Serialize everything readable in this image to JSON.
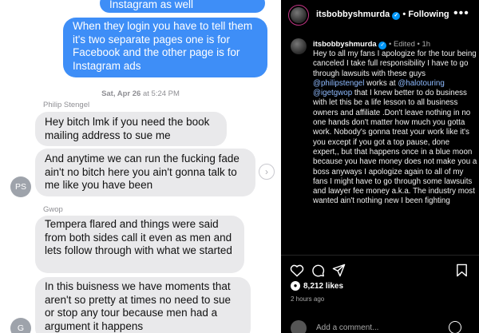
{
  "messages": {
    "sent_1": "Instagram as well",
    "sent_2": "When they login you have to tell them it's two separate pages one is for Facebook and the other page is for Instagram ads",
    "timestamp_day": "Sat, Apr 26",
    "timestamp_time": "at 5:24 PM",
    "philip_name": "Philip Stengel",
    "philip_msg_1": "Hey bitch lmk if you need the book mailing address to sue me",
    "philip_msg_2": "And anytime we can run the fucking fade ain't no bitch here you ain't gonna talk to me like you have been",
    "philip_initials": "PS",
    "gwop_name": "Gwop",
    "gwop_msg_1": "Tempera flared and things were said from both sides call it even as men and lets follow through with what we started",
    "gwop_msg_2": "In this buisness we have moments that aren't so pretty at times no need to sue or stop any tour because men had a argument it happens",
    "gwop_initials": "G"
  },
  "instagram": {
    "username": "itsbobbyshmurda",
    "follow_sep": " • ",
    "follow_label": "Following",
    "more_label": "•••",
    "edited": "• Edited • 1h",
    "caption_1": "Hey to all my fans I apologize for the tour being canceled I take full responsibility I have to go through lawsuits with these guys ",
    "mention_1": "@philipstengel",
    "caption_2": " works at ",
    "mention_2": "@halotouring",
    "mention_3": "@igetgwop",
    "caption_3": " that I knew better to do business with let this be a life lesson to all business owners and affiliate .Don't leave nothing in no one hands don't matter how much you gotta work. Nobody's gonna treat your work like it's you except if you got a top pause, done expert,, but that happens once in a blue moon because you have money does not make you a boss anyways I apologize again to all of my fans I might have to go through some lawsuits and lawyer fee money a.k.a. The industry most wanted ain't nothing new I been fighting",
    "likes": "8,212 likes",
    "time_ago": "2 hours ago",
    "comment_placeholder": "Add a comment..."
  }
}
